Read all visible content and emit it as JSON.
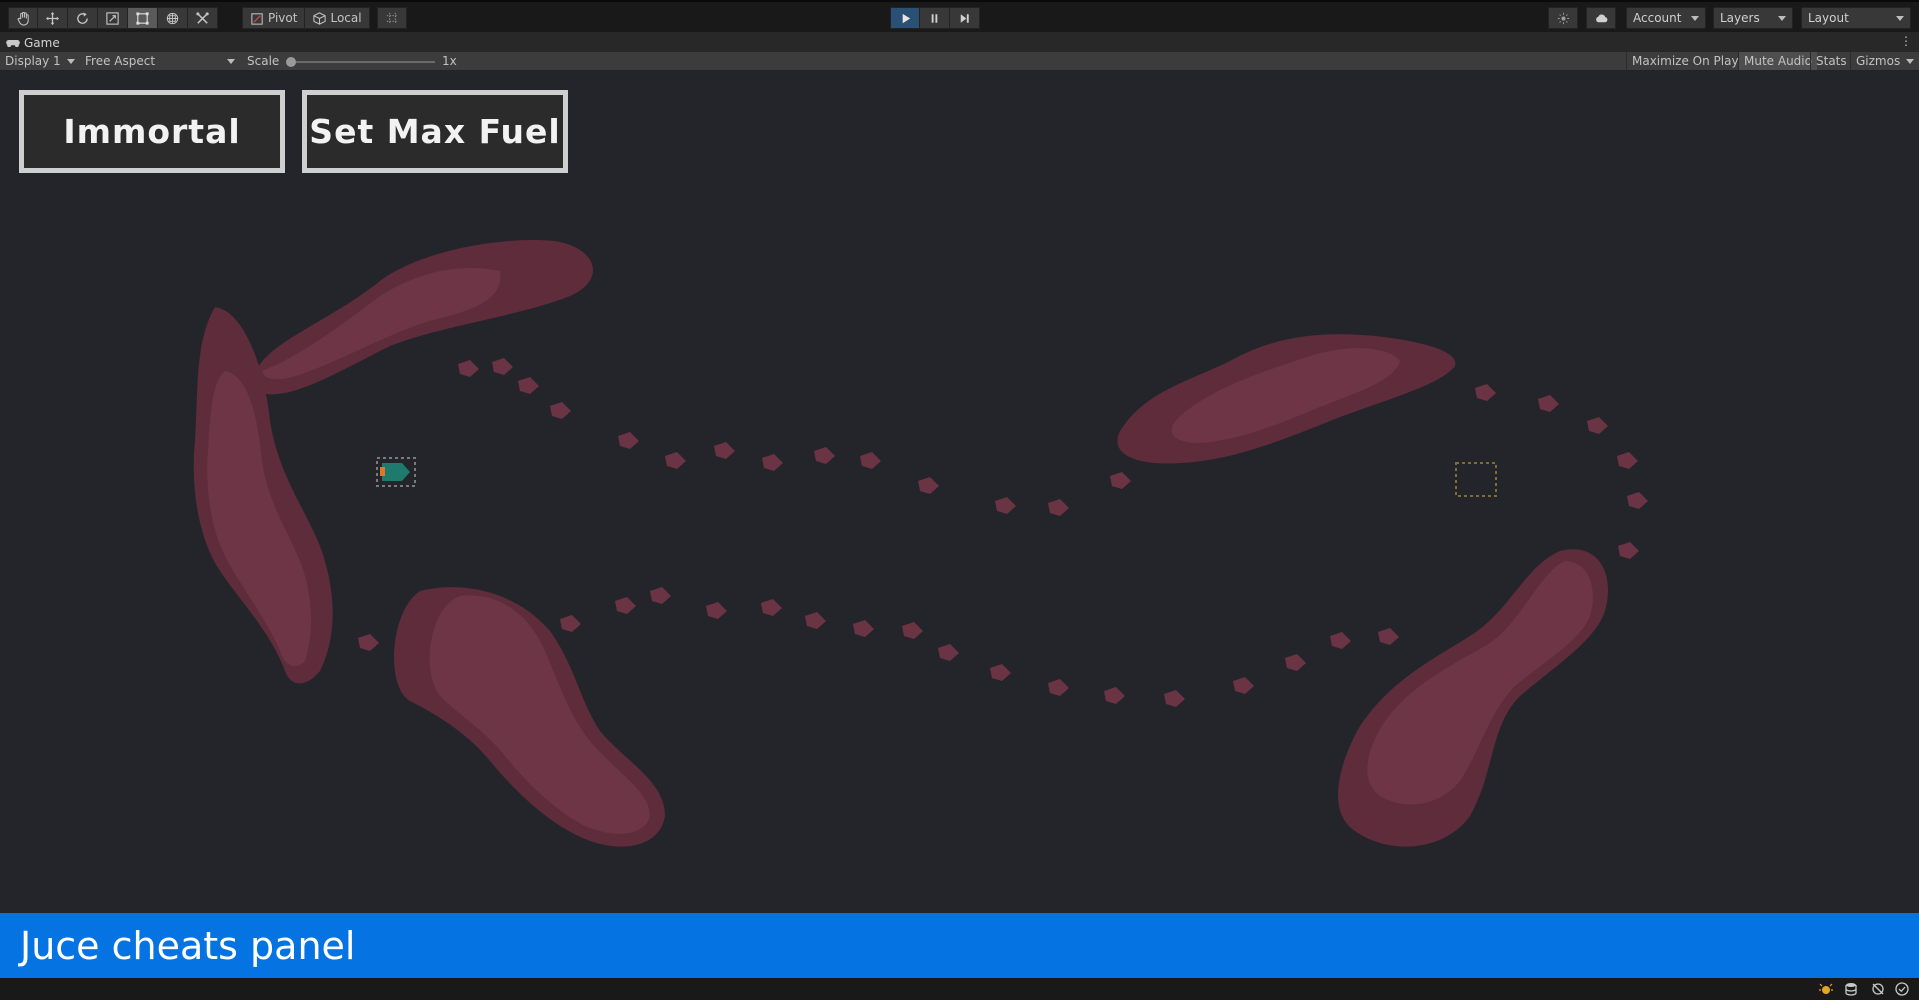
{
  "toolbar": {
    "tools": [
      "hand-tool-icon",
      "move-tool-icon",
      "rotate-tool-icon",
      "scale-tool-icon",
      "rect-tool-icon",
      "transform-tool-icon",
      "custom-tool-icon"
    ],
    "active_tool": "rect-tool-icon",
    "pivot_label": "Pivot",
    "local_label": "Local",
    "account_label": "Account",
    "layers_label": "Layers",
    "layout_label": "Layout"
  },
  "tab": {
    "title": "Game"
  },
  "game_controls": {
    "display": "Display 1",
    "aspect": "Free Aspect",
    "scale_label": "Scale",
    "scale_value": "1x",
    "scale_fraction": 0.0,
    "maximize_on_play": "Maximize On Play",
    "mute_audio": "Mute Audio",
    "stats": "Stats",
    "gizmos": "Gizmos"
  },
  "game": {
    "immortal_label": "Immortal",
    "max_fuel_label": "Set Max Fuel"
  },
  "juce_panel": {
    "title": "Juce cheats panel",
    "background_color": "#0574e2"
  },
  "colors": {
    "viewport_bg": "#24252b",
    "blob_dark": "#5e2c3b",
    "blob_light": "#6d3545",
    "marker": "#6b3444",
    "play_active": "#2a5075"
  }
}
